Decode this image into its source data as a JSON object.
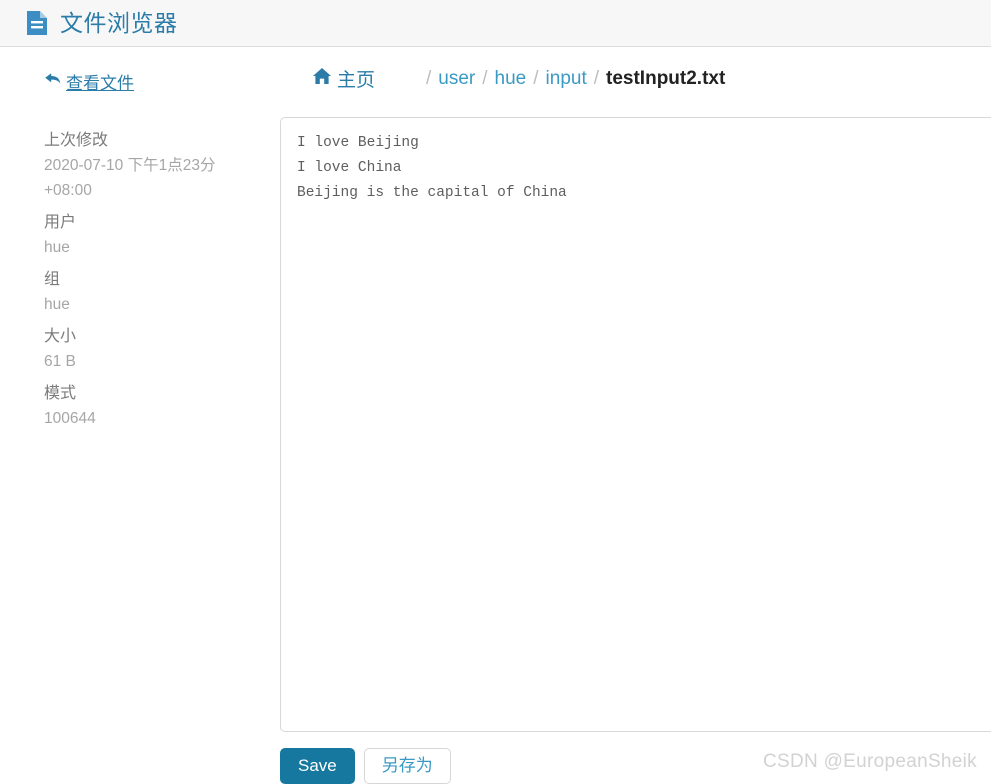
{
  "header": {
    "icon": "document-icon",
    "title": "文件浏览器"
  },
  "sidebar": {
    "back_link": {
      "icon": "back-arrow-icon",
      "label": "查看文件"
    },
    "meta": [
      {
        "label": "上次修改",
        "value": "2020-07-10 下午1点23分 +08:00"
      },
      {
        "label": "用户",
        "value": "hue"
      },
      {
        "label": "组",
        "value": "hue"
      },
      {
        "label": "大小",
        "value": "61 B"
      },
      {
        "label": "模式",
        "value": "100644"
      }
    ]
  },
  "breadcrumb": {
    "home": {
      "icon": "home-icon",
      "label": "主页"
    },
    "separator": "/",
    "items": [
      {
        "label": "user",
        "current": false
      },
      {
        "label": "hue",
        "current": false
      },
      {
        "label": "input",
        "current": false
      },
      {
        "label": "testInput2.txt",
        "current": true
      }
    ]
  },
  "editor": {
    "content": "I love Beijing\nI love China\nBeijing is the capital of China",
    "placeholder": ""
  },
  "actions": {
    "save_label": "Save",
    "save_as_label": "另存为"
  },
  "watermark": "CSDN @EuropeanSheik",
  "colors": {
    "accent": "#2b7ca8",
    "link": "#3a9ac4",
    "save_button": "#16789f",
    "header_bg": "#f7f7f7",
    "border": "#d8d8d8",
    "meta_label": "#7b7b7b",
    "meta_value": "#a6a6a6",
    "watermark": "#d2d2d2"
  }
}
